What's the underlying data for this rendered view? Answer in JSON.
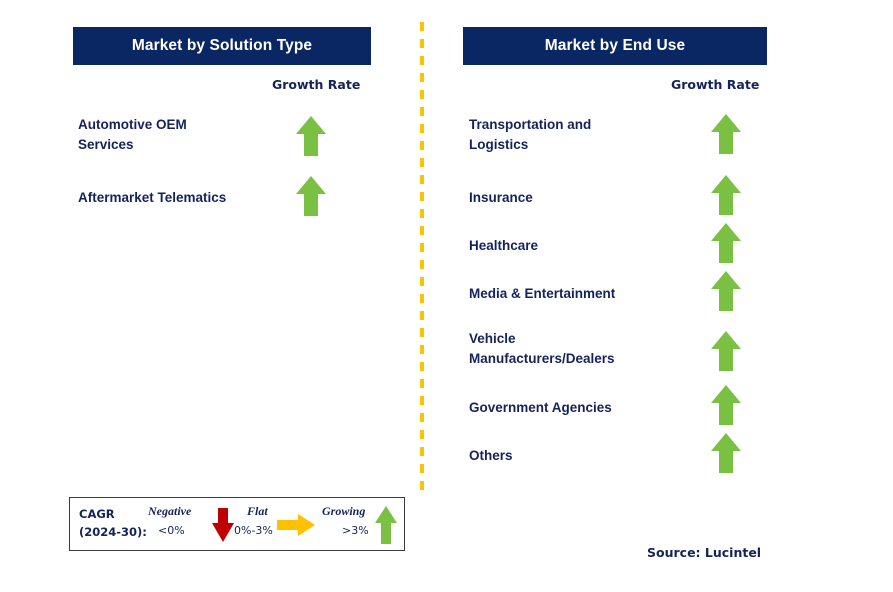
{
  "panels": [
    {
      "id": "solution-type",
      "title": "Market by Solution Type",
      "growth_rate_label": "Growth Rate",
      "items": [
        {
          "label": "Automotive OEM\nServices",
          "growth": "growing",
          "icon": "arrow-up-icon"
        },
        {
          "label": "Aftermarket Telematics",
          "growth": "growing",
          "icon": "arrow-up-icon"
        }
      ]
    },
    {
      "id": "end-use",
      "title": "Market by End Use",
      "growth_rate_label": "Growth Rate",
      "items": [
        {
          "label": "Transportation and\nLogistics",
          "growth": "growing",
          "icon": "arrow-up-icon"
        },
        {
          "label": "Insurance",
          "growth": "growing",
          "icon": "arrow-up-icon"
        },
        {
          "label": "Healthcare",
          "growth": "growing",
          "icon": "arrow-up-icon"
        },
        {
          "label": "Media & Entertainment",
          "growth": "growing",
          "icon": "arrow-up-icon"
        },
        {
          "label": "Vehicle\nManufacturers/Dealers",
          "growth": "growing",
          "icon": "arrow-up-icon"
        },
        {
          "label": "Government Agencies",
          "growth": "growing",
          "icon": "arrow-up-icon"
        },
        {
          "label": "Others",
          "growth": "growing",
          "icon": "arrow-up-icon"
        }
      ]
    }
  ],
  "legend": {
    "cagr_label": "CAGR\n(2024-30):",
    "entries": [
      {
        "title": "Negative",
        "range": "<0%",
        "icon": "arrow-down-icon",
        "color": "#c00000"
      },
      {
        "title": "Flat",
        "range": "0%-3%",
        "icon": "arrow-right-icon",
        "color": "#ffc000"
      },
      {
        "title": "Growing",
        "range": ">3%",
        "icon": "arrow-up-icon",
        "color": "#7ac143"
      }
    ]
  },
  "source": "Source: Lucintel",
  "colors": {
    "header_navy": "#0a2663",
    "text_navy": "#15235c",
    "growing_green": "#7ac143",
    "negative_red": "#c00000",
    "flat_yellow": "#ffc000",
    "divider_gold": "#fcc300"
  }
}
